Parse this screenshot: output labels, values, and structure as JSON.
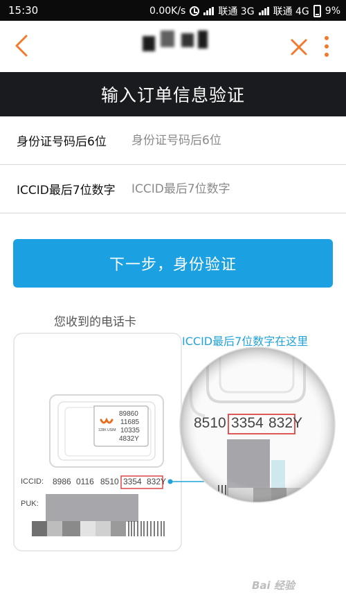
{
  "status_bar": {
    "time": "15:30",
    "speed": "0.00K/s",
    "carrier1": "联通 3G",
    "carrier2": "联通 4G",
    "battery": "9%"
  },
  "header": {
    "back_icon": "chevron-left-icon",
    "close_icon": "close-icon",
    "more_icon": "more-vertical-icon",
    "accent_color": "#f07a2e"
  },
  "page_title": "输入订单信息验证",
  "form": {
    "id_label": "身份证号码后6位",
    "id_placeholder": "身份证号码后6位",
    "iccid_label": "ICCID最后7位数字",
    "iccid_placeholder": "ICCID最后7位数字"
  },
  "next_button": {
    "label": "下一步，身份验证",
    "color": "#1ba1e2"
  },
  "illustration": {
    "card_caption": "您收到的电话卡",
    "iccid_hint": "ICCID最后7位数字在这里",
    "hint_color": "#21a3d8",
    "sim_numbers": [
      "89860",
      "11685",
      "10335",
      "4832Y"
    ],
    "sim_brand": "128K USIM",
    "iccid_label": "ICCID:",
    "iccid_groups": [
      "8986",
      "0116",
      "8510",
      "3354",
      "832Y"
    ],
    "puk_label": "PUK:",
    "magnified_groups": [
      "8510",
      "3354",
      "832Y"
    ]
  },
  "watermark": "Bai 经验"
}
